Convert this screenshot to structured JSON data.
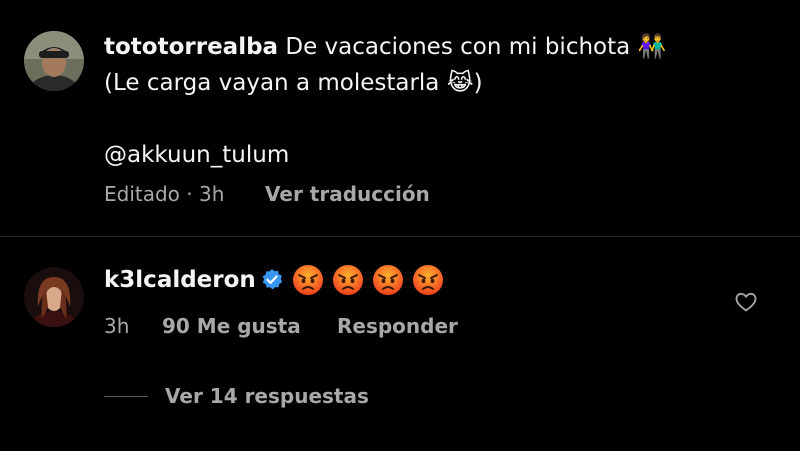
{
  "post": {
    "username": "tototorrealba",
    "caption_line1": "De vacaciones con mi bichota 👫",
    "caption_line2": "(Le carga vayan a molestarla 😹)",
    "mention": "@akkuun_tulum",
    "edited_time": "Editado · 3h",
    "translate_label": "Ver traducción"
  },
  "comment": {
    "username": "k3lcalderon",
    "verified": true,
    "emoji_icons": [
      "angry-face",
      "angry-face",
      "angry-face",
      "angry-face"
    ],
    "time": "3h",
    "likes": "90 Me gusta",
    "reply_label": "Responder",
    "view_replies_label": "Ver 14 respuestas"
  },
  "colors": {
    "background": "#000000",
    "text": "#f5f5f5",
    "secondary_text": "#a8a8a8",
    "verified_blue": "#3897f0",
    "divider": "#262626"
  }
}
